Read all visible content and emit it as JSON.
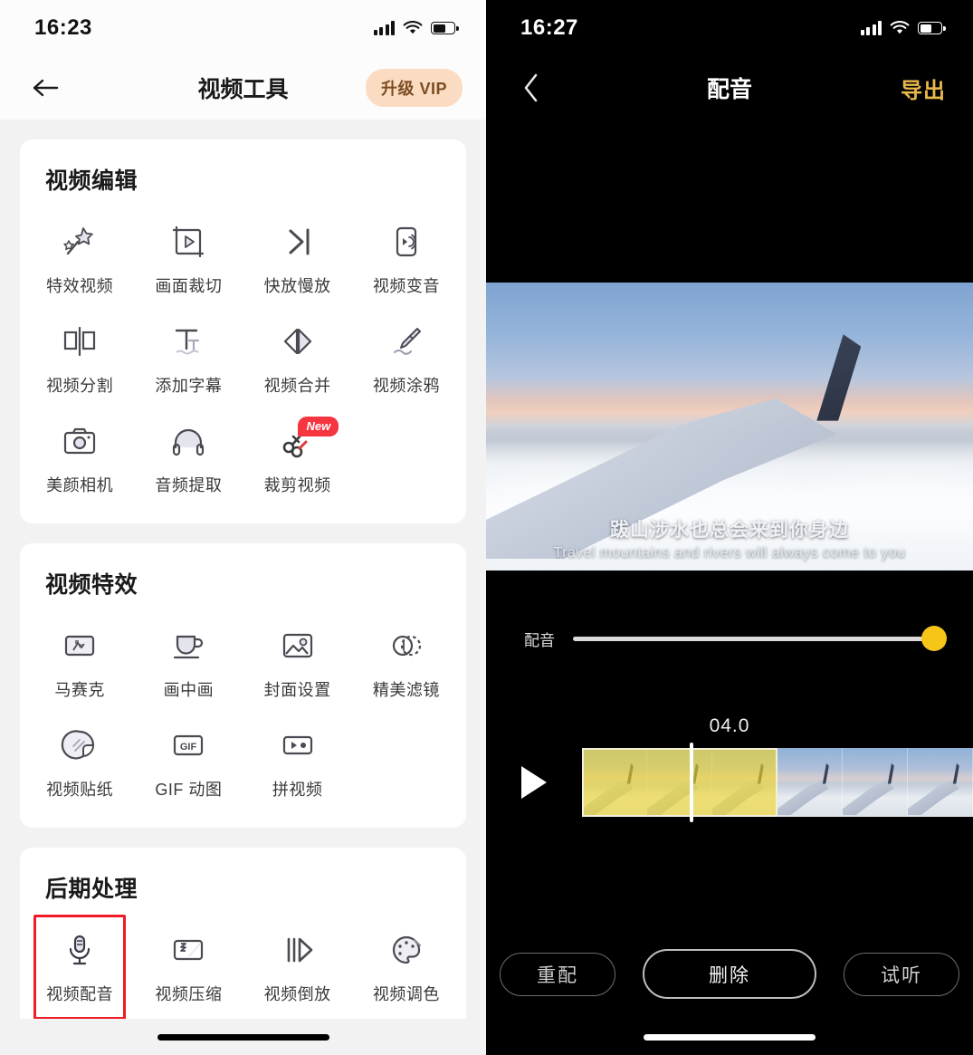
{
  "left_phone": {
    "status_bar": {
      "time": "16:23",
      "signal": "signal-bars",
      "wifi": "wifi-icon",
      "battery": "battery-icon"
    },
    "nav": {
      "back": "back-arrow",
      "title": "视频工具",
      "vip_label": "升级 VIP"
    },
    "sections": [
      {
        "title": "视频编辑",
        "tools": [
          {
            "label": "特效视频",
            "icon": "magic-wand-icon"
          },
          {
            "label": "画面裁切",
            "icon": "crop-video-icon"
          },
          {
            "label": "快放慢放",
            "icon": "speed-icon"
          },
          {
            "label": "视频变音",
            "icon": "voice-change-icon"
          },
          {
            "label": "视频分割",
            "icon": "split-icon"
          },
          {
            "label": "添加字幕",
            "icon": "subtitle-icon"
          },
          {
            "label": "视频合并",
            "icon": "merge-icon"
          },
          {
            "label": "视频涂鸦",
            "icon": "brush-icon"
          },
          {
            "label": "美颜相机",
            "icon": "camera-icon"
          },
          {
            "label": "音频提取",
            "icon": "headphone-icon"
          },
          {
            "label": "裁剪视频",
            "icon": "scissors-icon",
            "badge": "New"
          }
        ]
      },
      {
        "title": "视频特效",
        "tools": [
          {
            "label": "马赛克",
            "icon": "mosaic-icon"
          },
          {
            "label": "画中画",
            "icon": "picture-in-picture-icon"
          },
          {
            "label": "封面设置",
            "icon": "cover-image-icon"
          },
          {
            "label": "精美滤镜",
            "icon": "filter-icon"
          },
          {
            "label": "视频贴纸",
            "icon": "sticker-icon"
          },
          {
            "label": "GIF 动图",
            "icon": "gif-icon"
          },
          {
            "label": "拼视频",
            "icon": "splice-video-icon"
          }
        ]
      },
      {
        "title": "后期处理",
        "tools": [
          {
            "label": "视频配音",
            "icon": "microphone-icon",
            "highlighted": true
          },
          {
            "label": "视频压缩",
            "icon": "compress-icon"
          },
          {
            "label": "视频倒放",
            "icon": "reverse-icon"
          },
          {
            "label": "视频调色",
            "icon": "palette-icon"
          }
        ]
      }
    ],
    "highlight_color": "#ef1b26",
    "vip_bg_color": "#fbdcc2",
    "vip_text_color": "#7c4d22"
  },
  "right_phone": {
    "status_bar": {
      "time": "16:27",
      "signal": "signal-bars",
      "wifi": "wifi-icon",
      "battery": "battery-icon"
    },
    "nav": {
      "back": "back-chevron",
      "title": "配音",
      "export_label": "导出",
      "export_color": "#e8b84b"
    },
    "video": {
      "subtitle_cn": "跋山涉水也总会来到你身边",
      "subtitle_en": "Travel mountains and rivers will always come to you"
    },
    "slider": {
      "label": "配音",
      "value": 100,
      "thumb_color": "#f5c518"
    },
    "timeline": {
      "time_label": "04.0",
      "play_icon": "play-icon",
      "frame_count": 6,
      "selection_percent": 50,
      "playhead_percent": 27.5,
      "selection_color": "#f0d628"
    },
    "buttons": [
      {
        "label": "重配",
        "name": "redub-button",
        "size": "sm"
      },
      {
        "label": "删除",
        "name": "delete-button",
        "size": "lg"
      },
      {
        "label": "试听",
        "name": "preview-button",
        "size": "sm"
      }
    ]
  }
}
